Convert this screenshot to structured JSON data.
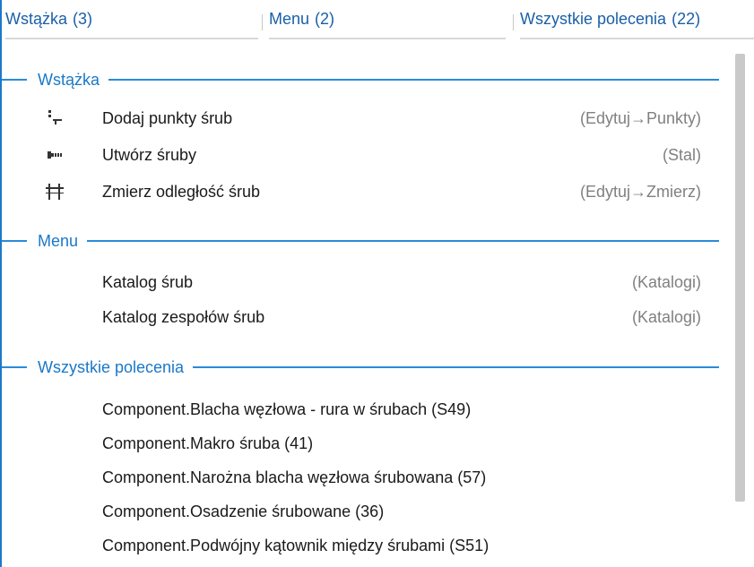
{
  "tabs": [
    {
      "label": "Wstążka",
      "count": "(3)"
    },
    {
      "label": "Menu",
      "count": "(2)"
    },
    {
      "label": "Wszystkie polecenia",
      "count": "(22)"
    }
  ],
  "sections": {
    "ribbon": {
      "title": "Wstążka",
      "items": [
        {
          "label": "Dodaj punkty śrub",
          "path": "(Edytuj→Punkty)",
          "icon": "add-bolt-points-icon"
        },
        {
          "label": "Utwórz śruby",
          "path": "(Stal)",
          "icon": "create-bolts-icon"
        },
        {
          "label": "Zmierz odległość śrub",
          "path": "(Edytuj→Zmierz)",
          "icon": "measure-bolt-distance-icon"
        }
      ]
    },
    "menu": {
      "title": "Menu",
      "items": [
        {
          "label": "Katalog śrub",
          "path": "(Katalogi)"
        },
        {
          "label": "Katalog zespołów śrub",
          "path": "(Katalogi)"
        }
      ]
    },
    "all": {
      "title": "Wszystkie polecenia",
      "items": [
        {
          "label": "Component.Blacha węzłowa - rura w śrubach (S49)"
        },
        {
          "label": "Component.Makro śruba (41)"
        },
        {
          "label": "Component.Narożna blacha węzłowa śrubowana (57)"
        },
        {
          "label": "Component.Osadzenie śrubowane (36)"
        },
        {
          "label": "Component.Podwójny kątownik między śrubami (S51)"
        }
      ]
    }
  },
  "colors": {
    "accent": "#1a78c8",
    "muted": "#808080"
  }
}
